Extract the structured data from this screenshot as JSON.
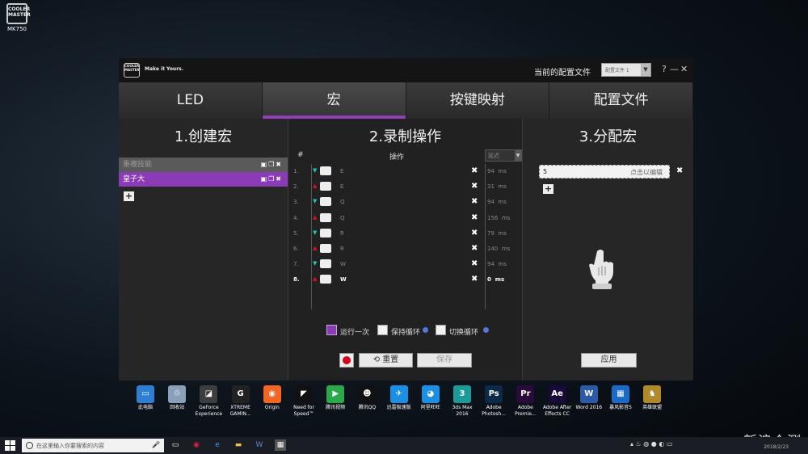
{
  "desktop": {
    "app_icon_label": "MK750",
    "app_logo_text": "COOLER MASTER"
  },
  "window": {
    "logo_text": "COOLER MASTER",
    "slogan": "Make it Yours.",
    "profile_label": "当前的配置文件",
    "profile_select": "配置文件 1",
    "help": "?",
    "minimize": "—",
    "close": "✕"
  },
  "tabs": [
    {
      "label": "LED",
      "active": false
    },
    {
      "label": "宏",
      "active": true
    },
    {
      "label": "按键映射",
      "active": false
    },
    {
      "label": "配置文件",
      "active": false
    }
  ],
  "create_macro": {
    "title": "1.创建宏",
    "items": [
      {
        "label": "重複技能",
        "selected": false
      },
      {
        "label": "皇子大",
        "selected": true
      }
    ],
    "row_icons": "▣❐✖",
    "add": "+"
  },
  "record": {
    "title": "2.录制操作",
    "col_hash": "#",
    "col_op": "操作",
    "delay_select": "延迟",
    "rows": [
      {
        "n": "1.",
        "dir": "▼",
        "dir_color": "#27c0b8",
        "key": "E",
        "delay": "94",
        "unit": "ms"
      },
      {
        "n": "2.",
        "dir": "▲",
        "dir_color": "#d8102a",
        "key": "E",
        "delay": "31",
        "unit": "ms"
      },
      {
        "n": "3.",
        "dir": "▼",
        "dir_color": "#27c0b8",
        "key": "Q",
        "delay": "94",
        "unit": "ms"
      },
      {
        "n": "4.",
        "dir": "▲",
        "dir_color": "#d8102a",
        "key": "Q",
        "delay": "156",
        "unit": "ms"
      },
      {
        "n": "5.",
        "dir": "▼",
        "dir_color": "#27c0b8",
        "key": "R",
        "delay": "79",
        "unit": "ms"
      },
      {
        "n": "6.",
        "dir": "▲",
        "dir_color": "#d8102a",
        "key": "R",
        "delay": "140",
        "unit": "ms"
      },
      {
        "n": "7.",
        "dir": "▼",
        "dir_color": "#27c0b8",
        "key": "W",
        "delay": "94",
        "unit": "ms"
      },
      {
        "n": "8.",
        "dir": "▲",
        "dir_color": "#d8102a",
        "key": "W",
        "delay": "0",
        "unit": "ms"
      }
    ],
    "delete_glyph": "✖",
    "run_once": "运行一次",
    "hold_loop": "保持循环",
    "toggle_loop": "切换循环",
    "reset": "重置",
    "save": "保存"
  },
  "assign": {
    "title": "3.分配宏",
    "key": "5",
    "hint": "点击以编辑",
    "delete": "✖",
    "add": "+",
    "apply": "应用"
  },
  "dock": [
    {
      "label": "此电脑",
      "color": "#2d7fd3",
      "glyph": "▭"
    },
    {
      "label": "回收站",
      "color": "#8aa0b8",
      "glyph": "♲"
    },
    {
      "label": "GeForce Experience",
      "color": "#3d3d3d",
      "glyph": "◪"
    },
    {
      "label": "XTREME GAMIN...",
      "color": "#222222",
      "glyph": "G"
    },
    {
      "label": "Origin",
      "color": "#f26522",
      "glyph": "◉"
    },
    {
      "label": "Need for Speed™",
      "color": "#111111",
      "glyph": "◤"
    },
    {
      "label": "腾讯视频",
      "color": "#2aa84a",
      "glyph": "▶"
    },
    {
      "label": "腾讯QQ",
      "color": "#111111",
      "glyph": "☻"
    },
    {
      "label": "迅雷极速版",
      "color": "#1a8fe3",
      "glyph": "✈"
    },
    {
      "label": "阿里旺旺",
      "color": "#1a8fe3",
      "glyph": "◕"
    },
    {
      "label": "3ds Max 2016",
      "color": "#1b9a9a",
      "glyph": "3"
    },
    {
      "label": "Adobe Photosh...",
      "color": "#0a2a4a",
      "glyph": "Ps"
    },
    {
      "label": "Adobe Premie...",
      "color": "#2a0a3a",
      "glyph": "Pr"
    },
    {
      "label": "Adobe After Effects CC",
      "color": "#1a0a3a",
      "glyph": "Ae"
    },
    {
      "label": "Word 2016",
      "color": "#2a5aa8",
      "glyph": "W"
    },
    {
      "label": "暴风影音5",
      "color": "#1a6ac8",
      "glyph": "▦"
    },
    {
      "label": "英雄联盟",
      "color": "#b08a2a",
      "glyph": "♞"
    }
  ],
  "taskbar": {
    "search_placeholder": "在这里输入你要搜索的内容",
    "clock": "2018/2/23",
    "watermark": "新浪众测"
  }
}
